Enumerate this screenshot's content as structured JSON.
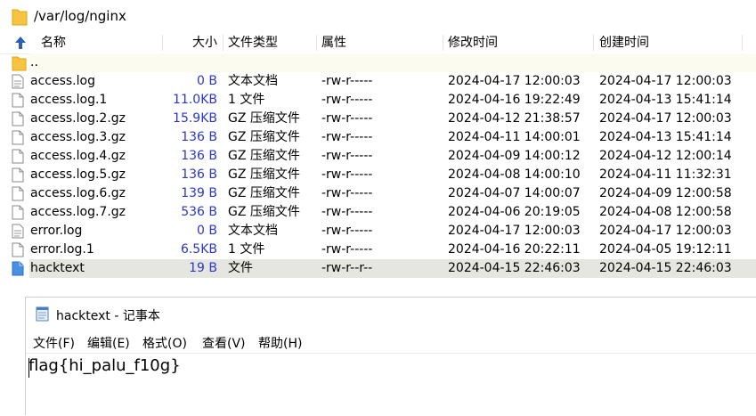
{
  "path_bar": {
    "path": "/var/log/nginx",
    "icon": "folder-icon"
  },
  "columns": {
    "name": "名称",
    "size": "大小",
    "type": "文件类型",
    "attr": "属性",
    "modified": "修改时间",
    "created": "创建时间"
  },
  "rows": [
    {
      "name": "..",
      "size": "",
      "type": "",
      "attr": "",
      "modified": "",
      "created": "",
      "icon": "folder-icon"
    },
    {
      "name": "access.log",
      "size": "0 B",
      "type": "文本文档",
      "attr": "-rw-r-----",
      "modified": "2024-04-17 12:00:03",
      "created": "2024-04-17 12:00:03",
      "icon": "text-file-icon"
    },
    {
      "name": "access.log.1",
      "size": "11.0KB",
      "type": "1 文件",
      "attr": "-rw-r-----",
      "modified": "2024-04-16 19:22:49",
      "created": "2024-04-13 15:41:14",
      "icon": "file-icon"
    },
    {
      "name": "access.log.2.gz",
      "size": "15.9KB",
      "type": "GZ 压缩文件",
      "attr": "-rw-r-----",
      "modified": "2024-04-12 21:38:57",
      "created": "2024-04-17 12:00:03",
      "icon": "file-icon"
    },
    {
      "name": "access.log.3.gz",
      "size": "136 B",
      "type": "GZ 压缩文件",
      "attr": "-rw-r-----",
      "modified": "2024-04-11 14:00:01",
      "created": "2024-04-13 15:41:14",
      "icon": "file-icon"
    },
    {
      "name": "access.log.4.gz",
      "size": "136 B",
      "type": "GZ 压缩文件",
      "attr": "-rw-r-----",
      "modified": "2024-04-09 14:00:12",
      "created": "2024-04-12 12:00:14",
      "icon": "file-icon"
    },
    {
      "name": "access.log.5.gz",
      "size": "136 B",
      "type": "GZ 压缩文件",
      "attr": "-rw-r-----",
      "modified": "2024-04-08 14:00:10",
      "created": "2024-04-11 11:32:31",
      "icon": "file-icon"
    },
    {
      "name": "access.log.6.gz",
      "size": "139 B",
      "type": "GZ 压缩文件",
      "attr": "-rw-r-----",
      "modified": "2024-04-07 14:00:07",
      "created": "2024-04-09 12:00:58",
      "icon": "file-icon"
    },
    {
      "name": "access.log.7.gz",
      "size": "536 B",
      "type": "GZ 压缩文件",
      "attr": "-rw-r-----",
      "modified": "2024-04-06 20:19:05",
      "created": "2024-04-08 12:00:58",
      "icon": "file-icon"
    },
    {
      "name": "error.log",
      "size": "0 B",
      "type": "文本文档",
      "attr": "-rw-r-----",
      "modified": "2024-04-17 12:00:03",
      "created": "2024-04-17 12:00:03",
      "icon": "text-file-icon"
    },
    {
      "name": "error.log.1",
      "size": "6.5KB",
      "type": "1 文件",
      "attr": "-rw-r-----",
      "modified": "2024-04-16 20:22:11",
      "created": "2024-04-05 19:12:11",
      "icon": "file-icon"
    },
    {
      "name": "hacktext",
      "size": "19 B",
      "type": "文件",
      "attr": "-rw-r--r--",
      "modified": "2024-04-15 22:46:03",
      "created": "2024-04-15 22:46:03",
      "icon": "blue-file-icon",
      "selected": true
    }
  ],
  "notepad": {
    "title": "hacktext - 记事本",
    "menu": [
      "文件(F)",
      "编辑(E)",
      "格式(O)",
      "查看(V)",
      "帮助(H)"
    ],
    "content": "flag{hi_palu_f10g}"
  },
  "colors": {
    "size_text": "#2a38c9",
    "selected_row": "#e6e6e1",
    "folder": "#f6c343",
    "blue_file": "#4a90e2"
  }
}
